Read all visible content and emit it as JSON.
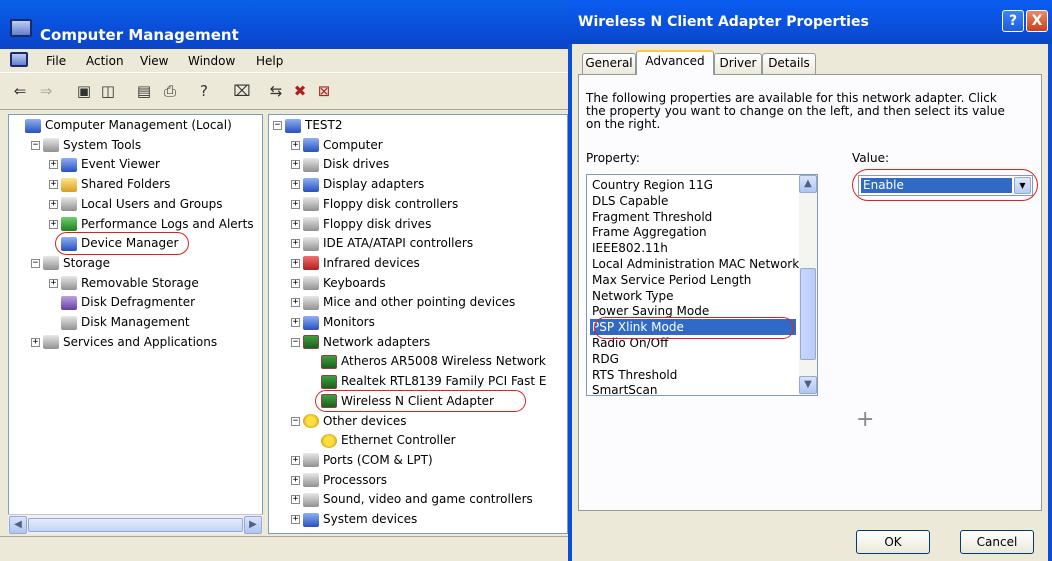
{
  "cm": {
    "title": "Computer Management",
    "menu": [
      "File",
      "Action",
      "View",
      "Window",
      "Help"
    ],
    "left_tree": [
      {
        "label": "Computer Management (Local)",
        "icon": "computer-management-icon",
        "level": 0
      },
      {
        "label": "System Tools",
        "icon": "system-tools-icon",
        "level": 1,
        "expander": "−"
      },
      {
        "label": "Event Viewer",
        "icon": "event-viewer-icon",
        "level": 2,
        "expander": "+"
      },
      {
        "label": "Shared Folders",
        "icon": "shared-folders-icon",
        "level": 2,
        "expander": "+"
      },
      {
        "label": "Local Users and Groups",
        "icon": "users-icon",
        "level": 2,
        "expander": "+"
      },
      {
        "label": "Performance Logs and Alerts",
        "icon": "performance-icon",
        "level": 2,
        "expander": "+"
      },
      {
        "label": "Device Manager",
        "icon": "device-manager-icon",
        "level": 2,
        "highlighted": true
      },
      {
        "label": "Storage",
        "icon": "storage-icon",
        "level": 1,
        "expander": "−"
      },
      {
        "label": "Removable Storage",
        "icon": "removable-storage-icon",
        "level": 2,
        "expander": "+"
      },
      {
        "label": "Disk Defragmenter",
        "icon": "defrag-icon",
        "level": 2
      },
      {
        "label": "Disk Management",
        "icon": "disk-management-icon",
        "level": 2
      },
      {
        "label": "Services and Applications",
        "icon": "services-icon",
        "level": 1,
        "expander": "+"
      }
    ],
    "device_tree": [
      {
        "label": "TEST2",
        "icon": "computer-icon",
        "level": 0,
        "expander": "−"
      },
      {
        "label": "Computer",
        "icon": "computer-icon",
        "level": 1,
        "expander": "+"
      },
      {
        "label": "Disk drives",
        "icon": "disk-drive-icon",
        "level": 1,
        "expander": "+"
      },
      {
        "label": "Display adapters",
        "icon": "display-adapter-icon",
        "level": 1,
        "expander": "+"
      },
      {
        "label": "Floppy disk controllers",
        "icon": "floppy-controller-icon",
        "level": 1,
        "expander": "+"
      },
      {
        "label": "Floppy disk drives",
        "icon": "floppy-drive-icon",
        "level": 1,
        "expander": "+"
      },
      {
        "label": "IDE ATA/ATAPI controllers",
        "icon": "ide-controller-icon",
        "level": 1,
        "expander": "+"
      },
      {
        "label": "Infrared devices",
        "icon": "infrared-icon",
        "level": 1,
        "expander": "+"
      },
      {
        "label": "Keyboards",
        "icon": "keyboard-icon",
        "level": 1,
        "expander": "+"
      },
      {
        "label": "Mice and other pointing devices",
        "icon": "mouse-icon",
        "level": 1,
        "expander": "+"
      },
      {
        "label": "Monitors",
        "icon": "monitor-icon",
        "level": 1,
        "expander": "+"
      },
      {
        "label": "Network adapters",
        "icon": "network-adapter-icon",
        "level": 1,
        "expander": "−"
      },
      {
        "label": "Atheros AR5008 Wireless Network",
        "icon": "network-card-icon",
        "level": 2
      },
      {
        "label": "Realtek RTL8139 Family PCI Fast E",
        "icon": "network-card-icon",
        "level": 2
      },
      {
        "label": "Wireless N Client Adapter",
        "icon": "network-card-icon",
        "level": 2,
        "highlighted": true
      },
      {
        "label": "Other devices",
        "icon": "unknown-device-icon",
        "level": 1,
        "expander": "−"
      },
      {
        "label": "Ethernet Controller",
        "icon": "warning-device-icon",
        "level": 2
      },
      {
        "label": "Ports (COM & LPT)",
        "icon": "port-icon",
        "level": 1,
        "expander": "+"
      },
      {
        "label": "Processors",
        "icon": "processor-icon",
        "level": 1,
        "expander": "+"
      },
      {
        "label": "Sound, video and game controllers",
        "icon": "sound-icon",
        "level": 1,
        "expander": "+"
      },
      {
        "label": "System devices",
        "icon": "system-device-icon",
        "level": 1,
        "expander": "+"
      }
    ]
  },
  "dlg": {
    "title": "Wireless N Client Adapter Properties",
    "help_label": "?",
    "close_label": "X",
    "tabs": [
      "General",
      "Advanced",
      "Driver",
      "Details"
    ],
    "active_tab": "Advanced",
    "description": "The following properties are available for this network adapter. Click the property you want to change on the left, and then select its value on the right.",
    "property_label": "Property:",
    "value_label": "Value:",
    "properties": [
      "Country Region 11G",
      "DLS Capable",
      "Fragment Threshold",
      "Frame Aggregation",
      "IEEE802.11h",
      "Local Administration MAC Network",
      "Max Service Period Length",
      "Network Type",
      "Power Saving Mode",
      "PSP Xlink Mode",
      "Radio On/Off",
      "RDG",
      "RTS Threshold",
      "SmartScan"
    ],
    "selected_property": "PSP Xlink Mode",
    "value": "Enable",
    "ok_label": "OK",
    "cancel_label": "Cancel"
  },
  "colors": {
    "xp_title_blue": "#0a4ed8",
    "selection_blue": "#316ac5",
    "dialog_face": "#ece9d8",
    "highlight_oval": "#e02020"
  }
}
